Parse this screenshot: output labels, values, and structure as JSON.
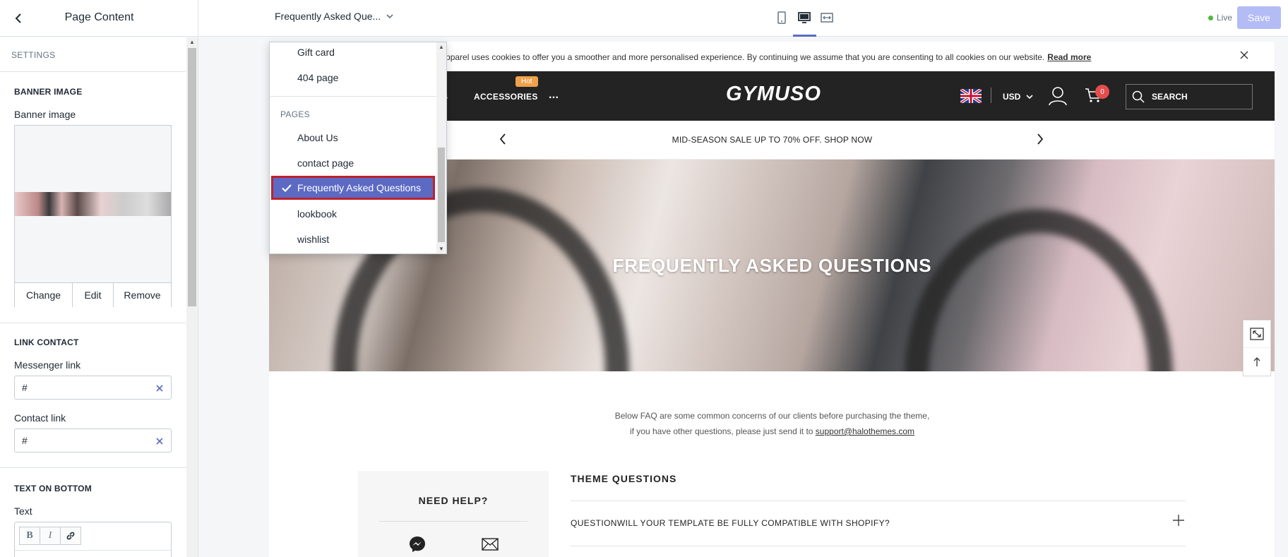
{
  "topbar": {
    "sidebar_title": "Page Content",
    "page_selector": "Frequently Asked Que...",
    "status": "Live",
    "save_label": "Save"
  },
  "sidebar": {
    "settings_heading": "SETTINGS",
    "banner_section": "BANNER IMAGE",
    "banner_label": "Banner image",
    "image_buttons": [
      "Change",
      "Edit",
      "Remove"
    ],
    "link_section": "LINK CONTACT",
    "messenger_label": "Messenger link",
    "messenger_value": "#",
    "contact_label": "Contact link",
    "contact_value": "#",
    "text_section": "TEXT ON BOTTOM",
    "text_label": "Text",
    "rte_buttons": [
      "B",
      "I"
    ]
  },
  "dropdown": {
    "items_before": [
      "Gift card",
      "404 page"
    ],
    "group": "PAGES",
    "pages": [
      "About Us",
      "contact page"
    ],
    "selected": "Frequently Asked Questions",
    "pages_after": [
      "lookbook",
      "wishlist"
    ]
  },
  "preview": {
    "cookie_text": "muso Apparel uses cookies to offer you a smoother and more personalised experience. By continuing we assume that you are consenting to all cookies on our website.",
    "cookie_link": "Read more",
    "nav_partial": "S",
    "nav_accessories": "ACCESSORIES",
    "nav_hot": "Hot",
    "nav_more": "...",
    "logo": "GYMUSO",
    "currency": "USD",
    "cart_count": "0",
    "search_label": "SEARCH",
    "promo": "MID-SEASON SALE UP TO 70% OFF. SHOP NOW",
    "hero_title": "FREQUENTLY ASKED QUESTIONS",
    "intro_line1": "Below FAQ are some common concerns of our clients before purchasing the theme,",
    "intro_line2": "if you have other questions, please just send it to",
    "intro_email": "support@halothemes.com",
    "help_title": "NEED HELP?",
    "questions_heading": "THEME QUESTIONS",
    "question1": "QUESTIONWILL YOUR TEMPLATE BE FULLY COMPATIBLE WITH SHOPIFY?"
  },
  "colors": {
    "accent": "#5c6ac4",
    "highlight_border": "#c0212e",
    "nav_bg": "#232323",
    "cart_badge": "#e54d4d",
    "hot_badge": "#f0a14a"
  }
}
